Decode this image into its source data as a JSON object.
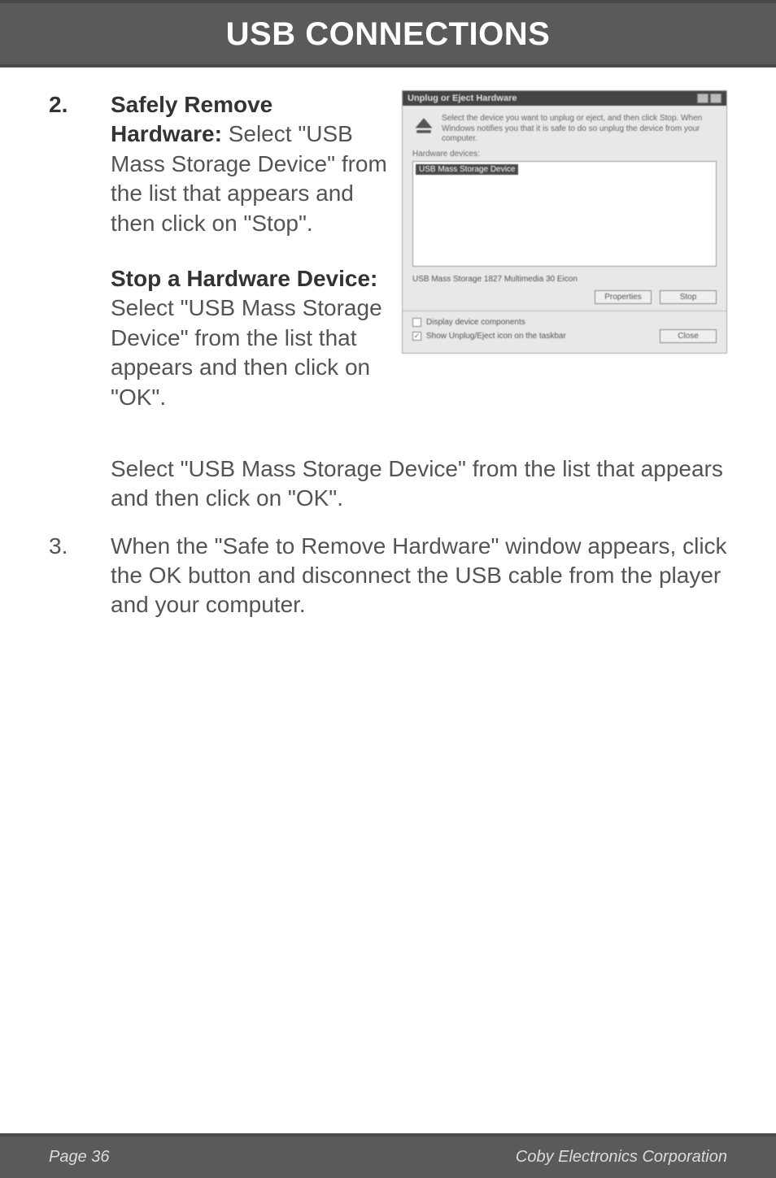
{
  "header": {
    "title": "USB CONNECTIONS"
  },
  "step2": {
    "number": "2.",
    "block1_bold": "Safely Remove Hardware:",
    "block1_rest": " Select \"USB Mass Storage Device\" from the list that appears and then click on \"Stop\".",
    "block2_bold": "Stop a Hardware Device:",
    "block2_rest": "  Select \"USB Mass Storage Device\" from the list that appears and then click on \"OK\".",
    "lower": "Select \"USB Mass Storage Device\" from the list that appears and then click on \"OK\"."
  },
  "dialog": {
    "title": "Unplug or Eject Hardware",
    "hint": "Select the device you want to unplug or eject, and then click Stop. When Windows notifies you that it is safe to do so unplug the device from your computer.",
    "label": "Hardware devices:",
    "selected": "USB Mass Storage Device",
    "desc": "USB Mass Storage 1827 Multimedia 30 Eicon",
    "properties_btn": "Properties",
    "stop_btn": "Stop",
    "chk1": "Display device components",
    "chk2": "Show Unplug/Eject icon on the taskbar",
    "close_btn": "Close"
  },
  "step3": {
    "number": "3.",
    "text": "When the \"Safe to Remove Hardware\" window appears, click the OK button and disconnect the USB cable from the player and your computer."
  },
  "footer": {
    "left": "Page 36",
    "right": "Coby Electronics Corporation"
  }
}
